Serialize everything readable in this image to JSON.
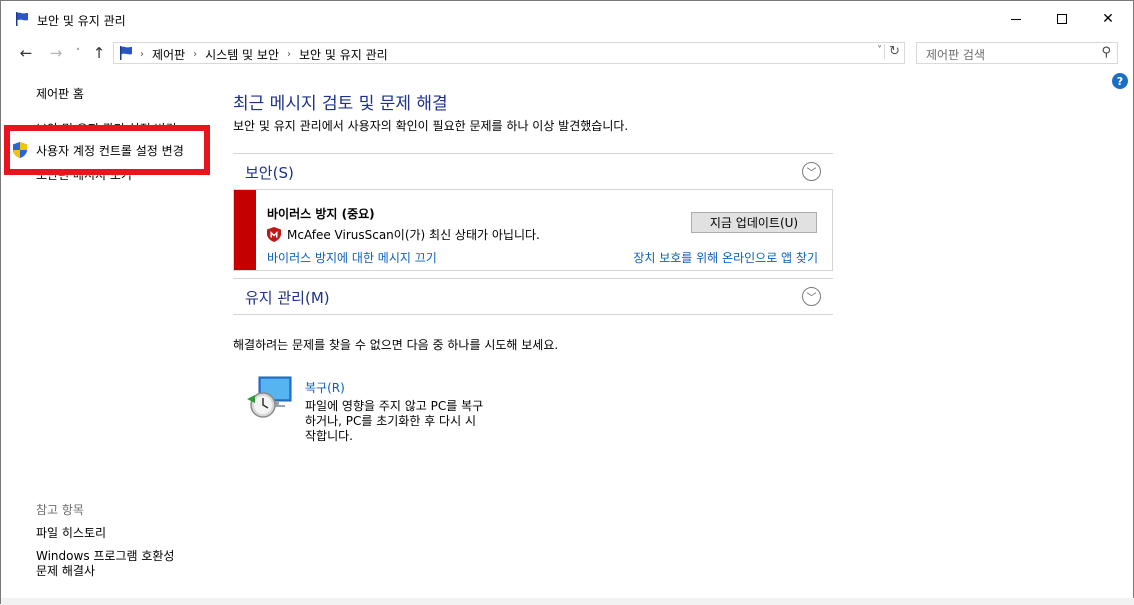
{
  "window": {
    "title": "보안 및 유지 관리"
  },
  "nav": {
    "back_icon": "arrow-left-icon",
    "forward_icon": "arrow-right-icon",
    "up_icon": "arrow-up-icon"
  },
  "address": {
    "crumbs": [
      "제어판",
      "시스템 및 보안",
      "보안 및 유지 관리"
    ]
  },
  "search": {
    "placeholder": "제어판 검색"
  },
  "sidebar": {
    "home": "제어판 홈",
    "change_settings_partial": "보안 및 유지 관리 설정 변경",
    "uac": "사용자 계정 컨트롤 설정 변경",
    "archived_partial": "보관된 메시지 보기",
    "see_also": "참고 항목",
    "file_history": "파일 히스토리",
    "compat_line1": "Windows 프로그램 호환성",
    "compat_line2": "문제 해결사"
  },
  "main": {
    "title": "최근 메시지 검토 및 문제 해결",
    "subtitle": "보안 및 유지 관리에서 사용자의 확인이 필요한 문제를 하나 이상 발견했습니다.",
    "security_section": "보안(S)",
    "maintenance_section": "유지 관리(M)",
    "alert": {
      "title": "바이러스 방지 (중요)",
      "message": "McAfee VirusScan이(가) 최신 상태가 아닙니다.",
      "update_button": "지금 업데이트(U)",
      "turn_off_link": "바이러스 방지에 대한 메시지 끄기",
      "find_app_link": "장치 보호를 위해 온라인으로 앱 찾기",
      "severity_color": "#c40000"
    },
    "try_text": "해결하려는 문제를 찾을 수 없으면 다음 중 하나를 시도해 보세요.",
    "recovery": {
      "title": "복구(R)",
      "desc_line1": "파일에 영향을 주지 않고 PC를 복구",
      "desc_line2": "하거나, PC를 초기화한 후 다시 시",
      "desc_line3": "작합니다."
    }
  },
  "colors": {
    "accent_title": "#1e3287",
    "link": "#0a5fbf",
    "highlight": "#e8141e"
  }
}
